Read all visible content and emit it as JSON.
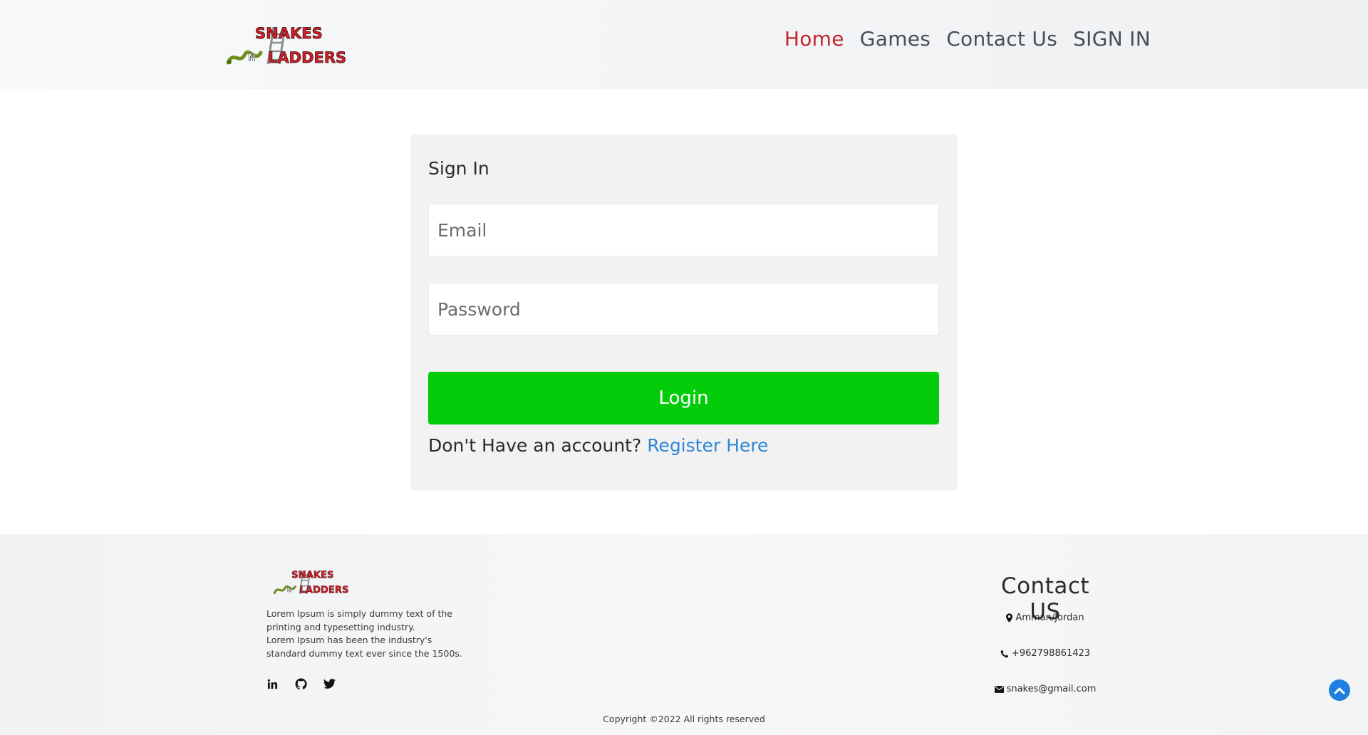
{
  "header": {
    "logo_text": [
      "SNAKES",
      "N",
      "LADDERS"
    ],
    "nav": [
      {
        "label": "Home",
        "active": true
      },
      {
        "label": "Games",
        "active": false
      },
      {
        "label": "Contact Us",
        "active": false
      },
      {
        "label": "SIGN IN",
        "active": false
      }
    ]
  },
  "signin": {
    "title": "Sign In",
    "email_placeholder": "Email",
    "email_value": "",
    "password_placeholder": "Password",
    "password_value": "",
    "login_label": "Login",
    "register_prompt": "Don't Have an account?",
    "register_link": "Register Here"
  },
  "footer": {
    "description_line1": "Lorem Ipsum is simply dummy text of the printing and typesetting industry.",
    "description_line2": "Lorem Ipsum has been the industry's standard dummy text ever since the 1500s.",
    "social_icons": [
      "linkedin-icon",
      "github-icon",
      "twitter-icon"
    ],
    "contact_heading": "Contact US",
    "location": "Amman/Jordan",
    "phone": "+962798861423",
    "email": "snakes@gmail.com",
    "copyright": "Copyright ©2022 All rights reserved"
  },
  "colors": {
    "brand_red": "#c0262c",
    "login_green": "#05cc0b",
    "link_blue": "#2f86d6",
    "scroll_top_blue": "#1f7fe0"
  }
}
